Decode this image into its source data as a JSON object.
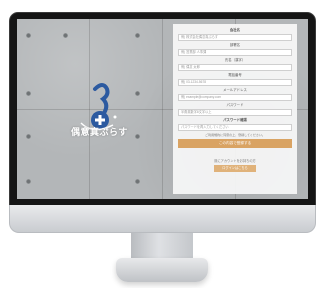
{
  "brand": {
    "logo_text": "偶意真ぷらす"
  },
  "form": {
    "fields": [
      {
        "label": "",
        "placeholder": "例) 株式会社偶意真ぷらす"
      },
      {
        "label": "部署名",
        "placeholder": "例) 営業部 人事課"
      },
      {
        "label": "氏名（漢字）",
        "placeholder": "例) 偶意 太郎"
      },
      {
        "label": "電話番号",
        "placeholder": "例) 03-1234-5678"
      },
      {
        "label": "メールアドレス",
        "placeholder": "例) example@company.com"
      },
      {
        "label": "パスワード",
        "placeholder": "半角英数字8文字以上"
      },
      {
        "label": "パスワード確認",
        "placeholder": "パスワードを再入力してください"
      }
    ],
    "notice": "ご利用規約に同意の上、登録してください。",
    "submit_label": "この内容で登録する"
  },
  "login": {
    "prompt": "既にアカウントをお持ちの方",
    "button_label": "ログインはこちら"
  },
  "colors": {
    "accent": "#d9a363",
    "logo_blue": "#2c5aa0"
  }
}
